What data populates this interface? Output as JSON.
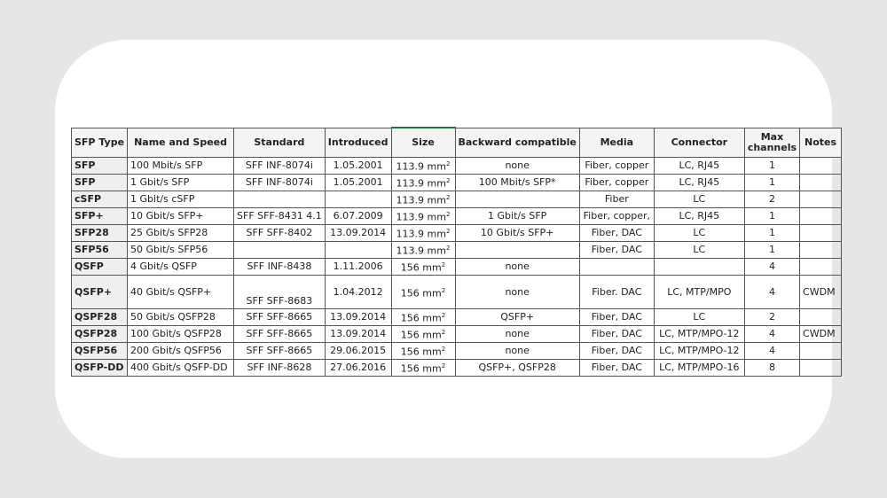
{
  "table": {
    "headers": [
      "SFP Type",
      "Name and Speed",
      "Standard",
      "Introduced",
      "Size",
      "Backward compatible",
      "Media",
      "Connector",
      "Max channels",
      "Notes"
    ],
    "size_unit_sup": "2",
    "rows": [
      [
        "SFP",
        "100 Mbit/s SFP",
        "SFF INF-8074i",
        "1.05.2001",
        "113.9 mm",
        "none",
        "Fiber, copper",
        "LC, RJ45",
        "1",
        ""
      ],
      [
        "SFP",
        "1 Gbit/s SFP",
        "SFF INF-8074i",
        "1.05.2001",
        "113.9 mm",
        "100 Mbit/s SFP*",
        "Fiber, copper",
        "LC, RJ45",
        "1",
        ""
      ],
      [
        "cSFP",
        "1 Gbit/s cSFP",
        "",
        "",
        "113.9 mm",
        "",
        "Fiber",
        "LC",
        "2",
        ""
      ],
      [
        "SFP+",
        "10 Gbit/s SFP+",
        "SFF SFF-8431 4.1",
        "6.07.2009",
        "113.9 mm",
        "1 Gbit/s SFP",
        "Fiber, copper,",
        "LC, RJ45",
        "1",
        ""
      ],
      [
        "SFP28",
        "25 Gbit/s SFP28",
        "SFF SFF-8402",
        "13.09.2014",
        "113.9 mm",
        "10 Gbit/s SFP+",
        "Fiber, DAC",
        "LC",
        "1",
        ""
      ],
      [
        "SFP56",
        "50 Gbit/s SFP56",
        "",
        "",
        "113.9 mm",
        "",
        "Fiber, DAC",
        "LC",
        "1",
        ""
      ],
      [
        "QSFP",
        "4 Gbit/s QSFP",
        "SFF INF-8438",
        "1.11.2006",
        "156 mm",
        "none",
        "",
        "",
        "4",
        ""
      ],
      [
        "QSFP+",
        "40 Gbit/s QSFP+",
        "SFF SFF-8683",
        "1.04.2012",
        "156 mm",
        "none",
        "Fiber. DAC",
        "LC, MTP/MPO",
        "4",
        "CWDM"
      ],
      [
        "QSPF28",
        "50 Gbit/s QSFP28",
        "SFF SFF-8665",
        "13.09.2014",
        "156 mm",
        "QSFP+",
        "Fiber, DAC",
        "LC",
        "2",
        ""
      ],
      [
        "QSFP28",
        "100 Gbit/s QSFP28",
        "SFF SFF-8665",
        "13.09.2014",
        "156 mm",
        "none",
        "Fiber, DAC",
        "LC, MTP/MPO-12",
        "4",
        "CWDM"
      ],
      [
        "QSFP56",
        "200 Gbit/s QSFP56",
        "SFF SFF-8665",
        "29.06.2015",
        "156 mm",
        "none",
        "Fiber, DAC",
        "LC, MTP/MPO-12",
        "4",
        ""
      ],
      [
        "QSFP-DD",
        "400 Gbit/s QSFP-DD",
        "SFF INF-8628",
        "27.06.2016",
        "156 mm",
        "QSFP+, QSFP28",
        "Fiber, DAC",
        "LC, MTP/MPO-16",
        "8",
        ""
      ]
    ]
  },
  "colors": {
    "selection_border": "#217346",
    "background": "#e6e6e6",
    "card": "#ffffff"
  }
}
